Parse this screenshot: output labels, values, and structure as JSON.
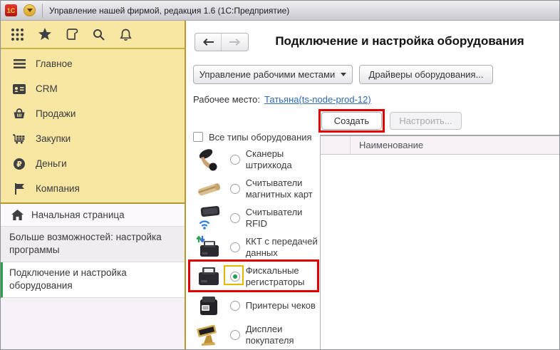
{
  "window": {
    "title": "Управление нашей фирмой, редакция 1.6  (1С:Предприятие)"
  },
  "sidebar": {
    "menu": [
      {
        "label": "Главное",
        "icon": "hamburger"
      },
      {
        "label": "CRM",
        "icon": "contact-card"
      },
      {
        "label": "Продажи",
        "icon": "basket"
      },
      {
        "label": "Закупки",
        "icon": "cart"
      },
      {
        "label": "Деньги",
        "icon": "ruble-coin"
      },
      {
        "label": "Компания",
        "icon": "flag"
      }
    ],
    "nav": [
      {
        "label": "Начальная страница",
        "icon": "home",
        "active": false
      },
      {
        "label": "Больше возможностей: настройка программы",
        "active": false
      },
      {
        "label": "Подключение и настройка оборудования",
        "active": true
      }
    ]
  },
  "content": {
    "title": "Подключение и настройка оборудования",
    "toolbar": {
      "workplaces_button": "Управление рабочими местами",
      "drivers_button": "Драйверы оборудования..."
    },
    "workplace": {
      "label": "Рабочее место:",
      "value": "Татьяна(ts-node-prod-12)"
    },
    "actions": {
      "create_button": "Создать",
      "configure_button": "Настроить...",
      "configure_disabled": true
    },
    "filter": {
      "all_types_label": "Все типы оборудования",
      "checked": false
    },
    "equipment_types": [
      {
        "label": "Сканеры штрихкода",
        "icon": "barcode-scanner",
        "selected": false
      },
      {
        "label": "Считыватели магнитных карт",
        "icon": "magstripe-reader",
        "selected": false
      },
      {
        "label": "Считыватели RFID",
        "icon": "rfid-reader",
        "selected": false
      },
      {
        "label": "ККТ с передачей данных",
        "icon": "kkt-online-printer",
        "selected": false
      },
      {
        "label": "Фискальные регистраторы",
        "icon": "fiscal-printer",
        "selected": true,
        "annotated": true
      },
      {
        "label": "Принтеры чеков",
        "icon": "receipt-printer",
        "selected": false
      },
      {
        "label": "Дисплеи покупателя",
        "icon": "customer-display",
        "selected": false
      }
    ],
    "table": {
      "name_column": "Наименование",
      "rows": []
    }
  },
  "colors": {
    "sidebar_yellow": "#f8e7a2",
    "divider_olive": "#b5992f",
    "active_nav_green": "#2e9e4f",
    "annotation_red": "#e00000",
    "annotation_yellow": "#e5b700",
    "radio_selected_green": "#1e9e50",
    "link_blue": "#3169b2"
  }
}
